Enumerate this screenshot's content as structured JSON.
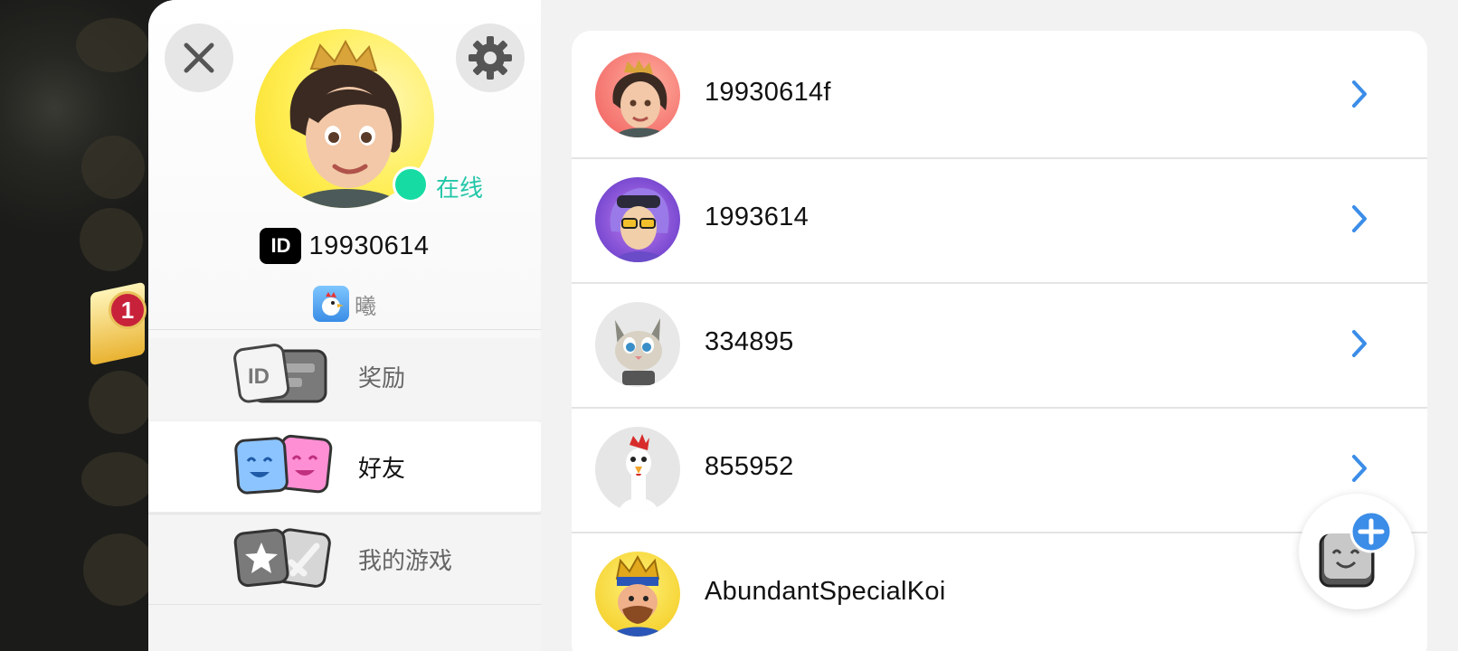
{
  "colors": {
    "accent": "#3b8de8",
    "online": "#16dca4",
    "online_text": "#22c7a8"
  },
  "game_bg": {
    "notification_badge": "1"
  },
  "profile": {
    "close_icon": "close-icon",
    "settings_icon": "gear-icon",
    "status": "在线",
    "id_badge": "ID",
    "user_id": "19930614",
    "nickname": "曦"
  },
  "menu": {
    "items": [
      {
        "label": "奖励",
        "icon": "id-cards-icon",
        "active": false
      },
      {
        "label": "好友",
        "icon": "smiley-cards-icon",
        "active": true
      },
      {
        "label": "我的游戏",
        "icon": "star-sword-cards-icon",
        "active": false
      }
    ]
  },
  "friends": [
    {
      "name": "19930614f",
      "avatar": "princess-avatar"
    },
    {
      "name": "1993614",
      "avatar": "purple-hair-avatar"
    },
    {
      "name": "334895",
      "avatar": "cat-avatar"
    },
    {
      "name": "855952",
      "avatar": "chicken-avatar"
    },
    {
      "name": "AbundantSpecialKoi",
      "avatar": "king-avatar"
    }
  ],
  "add_friend": {
    "icon": "add-friend-icon"
  }
}
